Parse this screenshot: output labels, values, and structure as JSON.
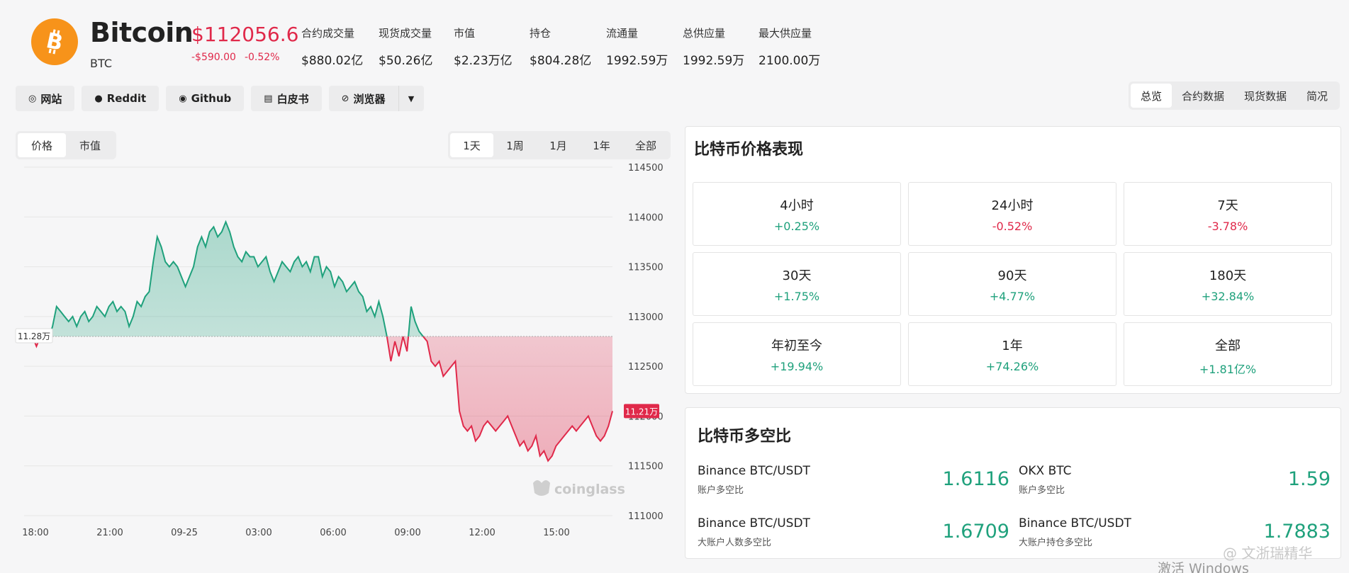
{
  "coin": {
    "name": "Bitcoin",
    "symbol": "BTC",
    "price": "$112056.6",
    "change_abs": "-$590.00",
    "change_pct": "-0.52%",
    "logo_icon": "bitcoin-icon",
    "logo_color": "#f7931a"
  },
  "stats": [
    {
      "label": "合约成交量",
      "value": "$880.02亿"
    },
    {
      "label": "现货成交量",
      "value": "$50.26亿"
    },
    {
      "label": "市值",
      "value": "$2.23万亿"
    },
    {
      "label": "持仓",
      "value": "$804.28亿"
    },
    {
      "label": "流通量",
      "value": "1992.59万"
    },
    {
      "label": "总供应量",
      "value": "1992.59万"
    },
    {
      "label": "最大供应量",
      "value": "2100.00万"
    }
  ],
  "links": [
    {
      "label": "网站",
      "icon": "globe-icon"
    },
    {
      "label": "Reddit",
      "icon": "reddit-icon"
    },
    {
      "label": "Github",
      "icon": "github-icon"
    },
    {
      "label": "白皮书",
      "icon": "document-icon"
    },
    {
      "label": "浏览器",
      "icon": "explorer-icon"
    }
  ],
  "view_tabs": [
    "总览",
    "合约数据",
    "现货数据",
    "简况"
  ],
  "chart_type_tabs": [
    "价格",
    "市值"
  ],
  "range_tabs": [
    "1天",
    "1周",
    "1月",
    "1年",
    "全部"
  ],
  "chart_data": {
    "type": "area",
    "watermark": "coinglass",
    "x_ticks": [
      "18:00",
      "21:00",
      "09-25",
      "03:00",
      "06:00",
      "09:00",
      "12:00",
      "15:00"
    ],
    "y_ticks": [
      114500,
      114000,
      113500,
      113000,
      112500,
      112000,
      111500,
      111000
    ],
    "ylim": [
      111000,
      114500
    ],
    "baseline": 112800,
    "baseline_label": "11.28万",
    "current_label": "11.21万",
    "up_color": "#1fa17c",
    "down_color": "#e0294a",
    "series": [
      {
        "values": [
          112750,
          112800,
          112700,
          112800,
          112850,
          112780,
          112900,
          113100,
          113050,
          113000,
          112950,
          113000,
          112900,
          113000,
          113050,
          112950,
          113000,
          113100,
          113050,
          113000,
          113100,
          113150,
          113050,
          113100,
          113050,
          112900,
          113000,
          113150,
          113100,
          113200,
          113250,
          113550,
          113800,
          113700,
          113550,
          113500,
          113550,
          113500,
          113400,
          113300,
          113400,
          113500,
          113700,
          113800,
          113700,
          113850,
          113900,
          113800,
          113850,
          113950,
          113850,
          113700,
          113600,
          113550,
          113650,
          113600,
          113600,
          113500,
          113550,
          113600,
          113450,
          113350,
          113450,
          113550,
          113500,
          113450,
          113550,
          113600,
          113500,
          113550,
          113450,
          113600,
          113600,
          113400,
          113500,
          113450,
          113300,
          113400,
          113350,
          113250,
          113300,
          113350,
          113250,
          113200,
          113050,
          113100,
          113000,
          113150,
          113000,
          112800,
          112550,
          112750,
          112600,
          112800,
          112650,
          113100,
          112950,
          112850,
          112800,
          112750,
          112550,
          112500,
          112550,
          112400,
          112450,
          112500,
          112550,
          112050,
          111900,
          111850,
          111900,
          111750,
          111800,
          111900,
          111950,
          111900,
          111850,
          111900,
          111950,
          112000,
          111900,
          111800,
          111700,
          111750,
          111650,
          111700,
          111800,
          111600,
          111650,
          111550,
          111600,
          111700,
          111750,
          111800,
          111850,
          111900,
          111850,
          111900,
          111950,
          112000,
          111900,
          111800,
          111750,
          111800,
          111900,
          112050
        ]
      }
    ]
  },
  "perf_panel": {
    "title": "比特币价格表现",
    "cells": [
      {
        "label": "4小时",
        "value": "+0.25%",
        "dir": "up"
      },
      {
        "label": "24小时",
        "value": "-0.52%",
        "dir": "down"
      },
      {
        "label": "7天",
        "value": "-3.78%",
        "dir": "down"
      },
      {
        "label": "30天",
        "value": "+1.75%",
        "dir": "up"
      },
      {
        "label": "90天",
        "value": "+4.77%",
        "dir": "up"
      },
      {
        "label": "180天",
        "value": "+32.84%",
        "dir": "up"
      },
      {
        "label": "年初至今",
        "value": "+19.94%",
        "dir": "up"
      },
      {
        "label": "1年",
        "value": "+74.26%",
        "dir": "up"
      },
      {
        "label": "全部",
        "value": "+1.81亿%",
        "dir": "up"
      }
    ]
  },
  "ls_panel": {
    "title": "比特币多空比",
    "items": [
      {
        "exchange": "Binance BTC/USDT",
        "sub": "账户多空比",
        "value": "1.6116"
      },
      {
        "exchange": "OKX BTC",
        "sub": "账户多空比",
        "value": "1.59"
      },
      {
        "exchange": "Binance BTC/USDT",
        "sub": "大账户人数多空比",
        "value": "1.6709"
      },
      {
        "exchange": "Binance BTC/USDT",
        "sub": "大账户持仓多空比",
        "value": "1.7883"
      }
    ]
  },
  "overlay": {
    "windows_text": "激活 Windows",
    "social_text": "@ 文浙瑞精华"
  }
}
